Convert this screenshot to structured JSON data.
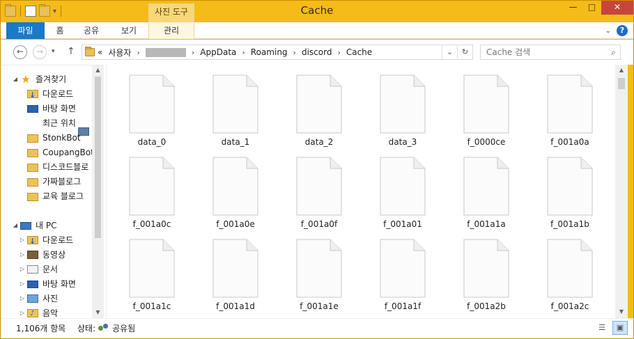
{
  "window": {
    "title": "Cache",
    "tools_tab_title": "사진 도구",
    "buttons": {
      "minimize": "—",
      "maximize": "□",
      "close": "✕"
    }
  },
  "ribbon": {
    "tabs": [
      {
        "label": "파일"
      },
      {
        "label": "홈"
      },
      {
        "label": "공유"
      },
      {
        "label": "보기"
      },
      {
        "label": "관리"
      }
    ],
    "help": "?"
  },
  "address": {
    "crumbs": [
      "«",
      "사용자",
      "AppData",
      "Roaming",
      "discord",
      "Cache"
    ],
    "search_placeholder": "Cache 검색"
  },
  "nav": {
    "favorites_label": "즐겨찾기",
    "favorites": [
      {
        "label": "다운로드",
        "icon": "download-folder-icon"
      },
      {
        "label": "바탕 화면",
        "icon": "desktop-icon"
      },
      {
        "label": "최근 위치",
        "icon": "recent-places-icon"
      },
      {
        "label": "StonkBot",
        "icon": "folder-icon"
      },
      {
        "label": "CoupangBot",
        "icon": "folder-icon"
      },
      {
        "label": "디스코드블로",
        "icon": "folder-icon"
      },
      {
        "label": "가짜블로그",
        "icon": "folder-icon"
      },
      {
        "label": "교육 블로그",
        "icon": "folder-icon"
      }
    ],
    "pc_label": "내 PC",
    "pc_items": [
      {
        "label": "다운로드",
        "icon": "download-folder-icon"
      },
      {
        "label": "동영상",
        "icon": "videos-icon"
      },
      {
        "label": "문서",
        "icon": "documents-icon"
      },
      {
        "label": "바탕 화면",
        "icon": "desktop-icon"
      },
      {
        "label": "사진",
        "icon": "pictures-icon"
      },
      {
        "label": "음악",
        "icon": "music-icon"
      }
    ]
  },
  "files": [
    "data_0",
    "data_1",
    "data_2",
    "data_3",
    "f_0000ce",
    "f_001a0a",
    "f_001a0c",
    "f_001a0e",
    "f_001a0f",
    "f_001a01",
    "f_001a1a",
    "f_001a1b",
    "f_001a1c",
    "f_001a1d",
    "f_001a1e",
    "f_001a1f",
    "f_001a2b",
    "f_001a2c"
  ],
  "status": {
    "count": "1,106개 항목",
    "state_label": "상태:",
    "state_value": "공유됨"
  }
}
